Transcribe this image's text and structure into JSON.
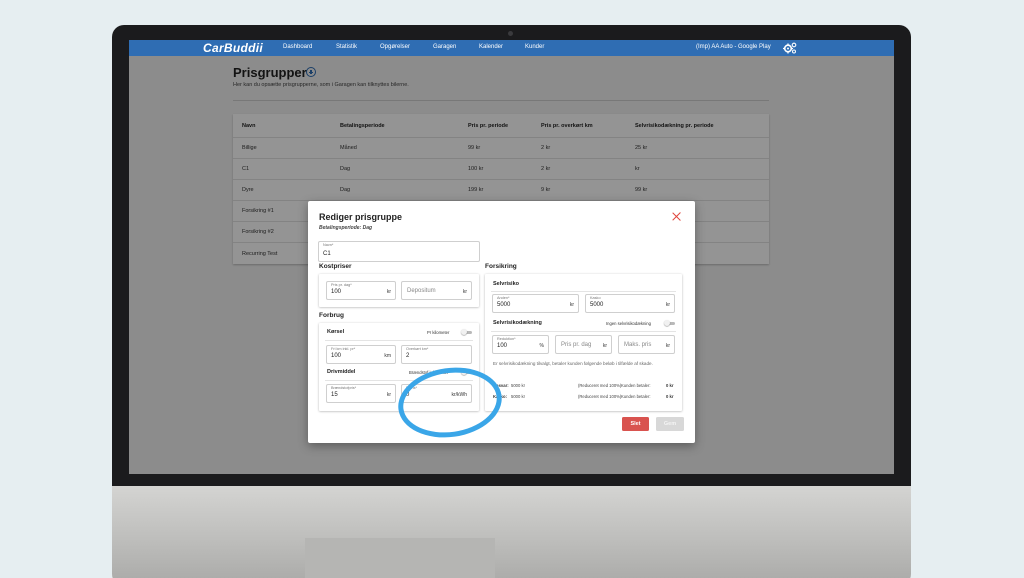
{
  "nav": {
    "logo": "CarBuddii",
    "items": [
      "Dashboard",
      "Statistik",
      "Opgørelser",
      "Garagen",
      "Kalender",
      "Kunder"
    ],
    "account": "(Imp) AA Auto - Google Play",
    "settings_icon": "gears-icon",
    "color": "#2f6db3"
  },
  "page": {
    "title": "Prisgrupper",
    "add_icon": "plus-circle-icon",
    "subtitle": "Her kan du opsætte prisgrupperne, som i Garagen kan tilknyttes bilerne."
  },
  "table": {
    "headers": [
      "Navn",
      "Betalingsperiode",
      "Pris pr. periode",
      "Pris pr. overkørt km",
      "Selvrisikodækning pr. periode"
    ],
    "rows": [
      [
        "Billige",
        "Måned",
        "99 kr",
        "2 kr",
        "25 kr"
      ],
      [
        "C1",
        "Dag",
        "100 kr",
        "2 kr",
        "kr"
      ],
      [
        "Dyre",
        "Dag",
        "199 kr",
        "9 kr",
        "99 kr"
      ],
      [
        "Forsikring #1",
        "",
        "",
        "",
        ""
      ],
      [
        "Forsikring #2",
        "",
        "",
        "",
        ""
      ],
      [
        "Recurring Test",
        "",
        "",
        "",
        ""
      ]
    ]
  },
  "modal": {
    "title": "Rediger prisgruppe",
    "subtitle": "Betalingsperiode: Dag",
    "close_icon": "close-icon",
    "name_label": "Navn*",
    "name_value": "C1",
    "kostpriser": {
      "title": "Kostpriser",
      "price_label": "Pris pr. dag*",
      "price_value": "100",
      "price_unit": "kr",
      "deposit_placeholder": "Depositum",
      "deposit_unit": "kr"
    },
    "forbrug": {
      "title": "Forbrug",
      "korsel_title": "Kørsel",
      "per_km_label": "Pr kilometer",
      "free_km_label": "Fri km inkl. pr*",
      "free_km_value": "100",
      "free_km_unit": "km",
      "over_km_label": "Overkørt km*",
      "over_km_value": "2",
      "drivmiddel_title": "Drivmiddel",
      "fuel_included_label": "Brændstof inkluderet",
      "fuel_price_label": "Brændstofpris*",
      "fuel_price_value": "15",
      "fuel_price_unit": "kr",
      "el_price_label": "Elpris*",
      "el_price_value": "0",
      "el_price_unit": "kr/kWh"
    },
    "forsikring": {
      "title": "Forsikring",
      "selvrisiko_title": "Selvrisiko",
      "anden_label": "Anden*",
      "anden_value": "5000",
      "anden_unit": "kr",
      "kasko_label": "Kasko",
      "kasko_value": "5000",
      "kasko_unit": "kr",
      "daekning_title": "Selvrisikodækning",
      "no_cover_label": "Ingen selvrisikodækning",
      "reduction_label": "Reduktion*",
      "reduction_value": "100",
      "reduction_unit": "%",
      "price_day_placeholder": "Pris pr. dag",
      "price_day_unit": "kr",
      "max_price_placeholder": "Maks. pris",
      "max_price_unit": "kr",
      "info": "Er selvrisikodækning tilvalgt, betaler kunden følgende beløb i tilfælde af skade.",
      "rows": [
        {
          "label": "Ansvar:",
          "amount": "5000 kr",
          "note": "(Reduceret med 100%)",
          "pays_label": "Kunden betaler:",
          "pays_value": "0 kr"
        },
        {
          "label": "Kasko:",
          "amount": "5000 kr",
          "note": "(Reduceret med 100%)",
          "pays_label": "Kunden betaler:",
          "pays_value": "0 kr"
        }
      ]
    },
    "delete_label": "Slet",
    "save_label": "Gem"
  },
  "colors": {
    "accent": "#2f6db3",
    "danger": "#d9534f",
    "highlight": "#3aa6e8"
  }
}
